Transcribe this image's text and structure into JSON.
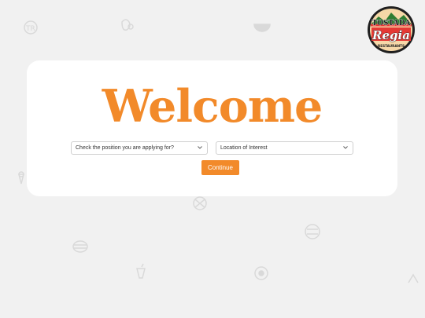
{
  "brand": {
    "logo_top": "TOSTADA",
    "logo_main": "Regia",
    "logo_sub": "RESTAURANTS"
  },
  "welcome": {
    "heading": "Welcome"
  },
  "form": {
    "position_select": "Check the position you are applying for?",
    "location_select": "Location of Interest",
    "continue_label": "Continue"
  },
  "colors": {
    "accent": "#f28a2a",
    "background": "#f1f1f1",
    "card": "#ffffff"
  },
  "icons": {
    "select_chevron": "chevron-down-icon",
    "background_pattern": "food-doodle-icons"
  }
}
